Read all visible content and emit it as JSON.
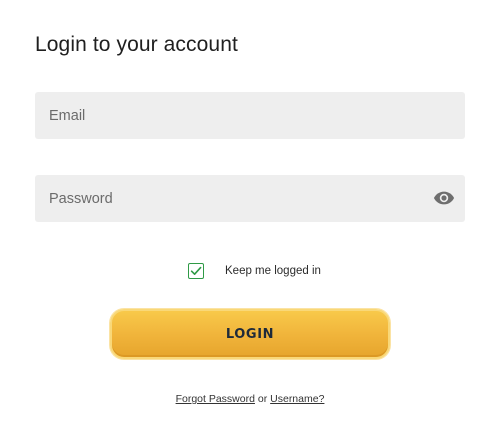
{
  "page": {
    "title": "Login to your account"
  },
  "form": {
    "email": {
      "placeholder": "Email",
      "value": ""
    },
    "password": {
      "placeholder": "Password",
      "value": "",
      "toggle_icon": "eye-icon"
    },
    "remember": {
      "label": "Keep me logged in",
      "checked": true,
      "check_color": "#2f9a46"
    },
    "submit": {
      "label": "LOGIN",
      "color": "#f0b33a"
    }
  },
  "footer": {
    "forgot_password": "Forgot Password",
    "separator": "or",
    "username": "Username?"
  }
}
